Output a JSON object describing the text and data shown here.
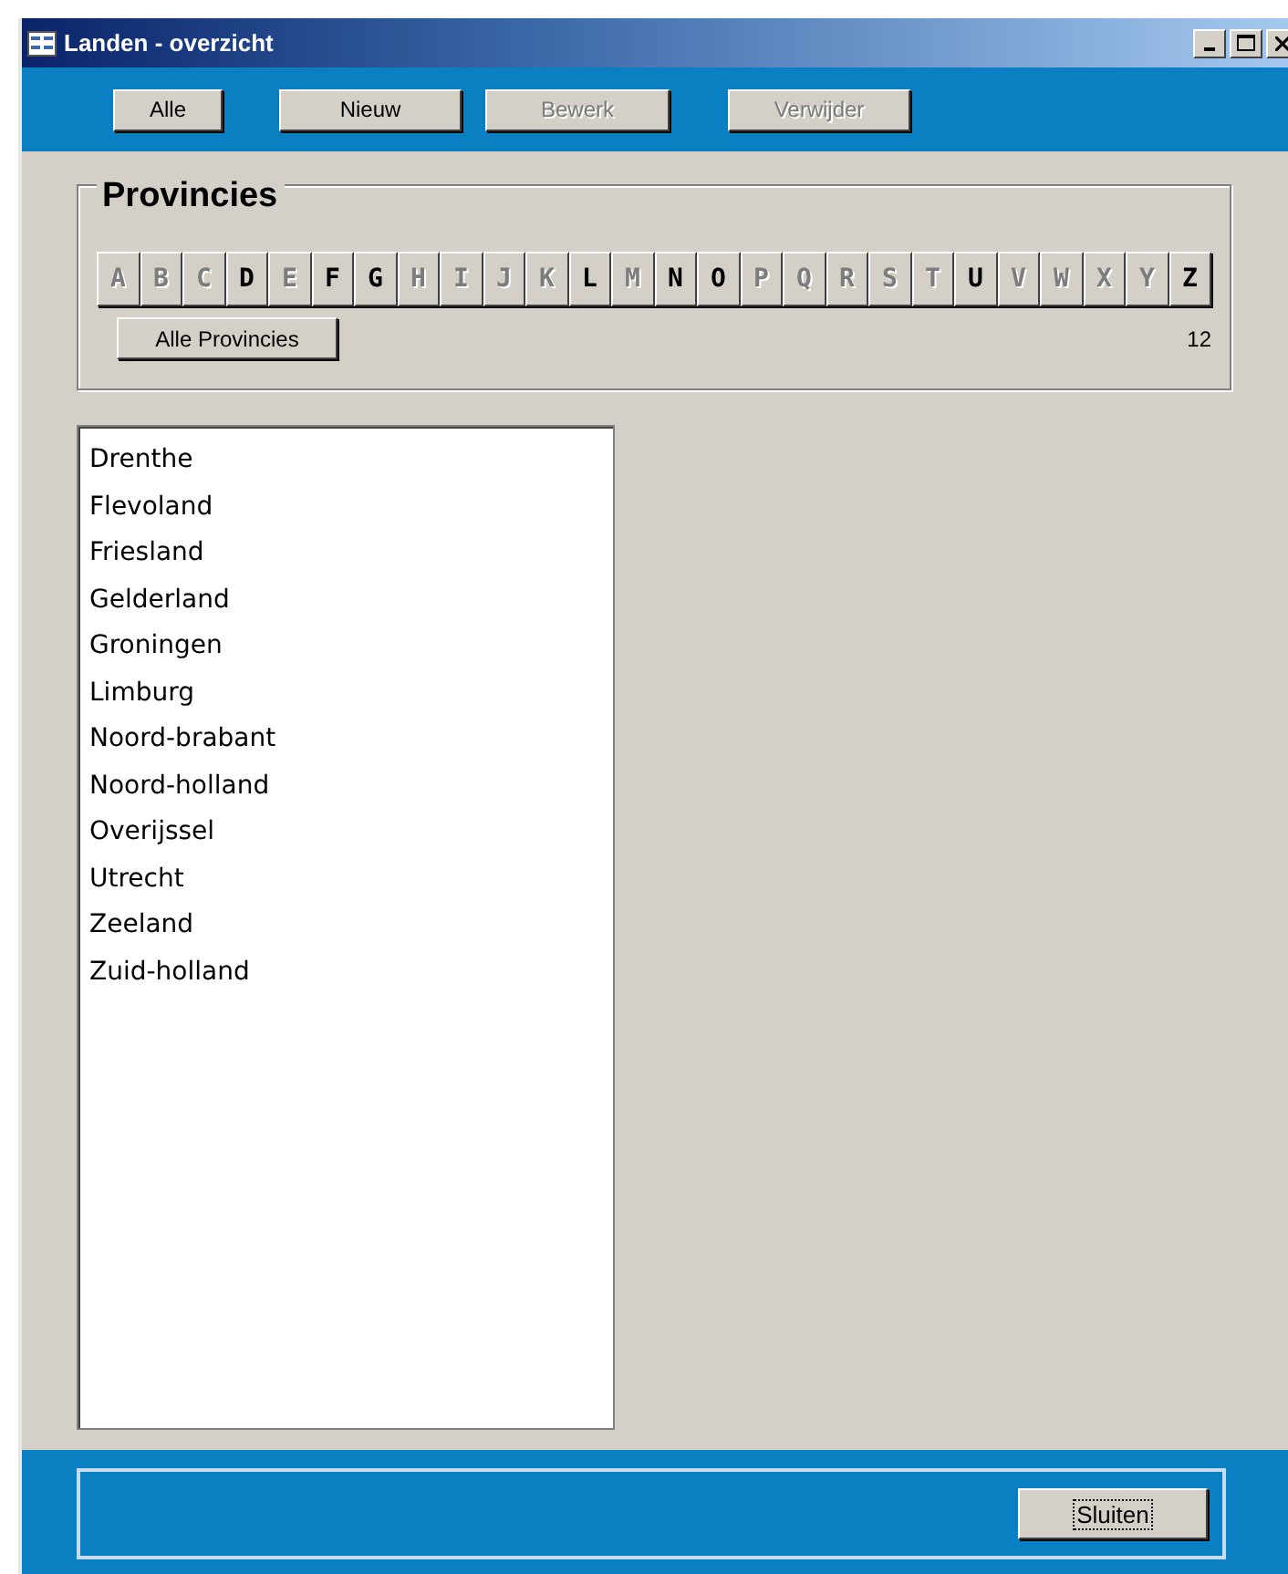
{
  "window": {
    "title": "Landen - overzicht"
  },
  "toolbar": [
    {
      "label": "Alle",
      "disabled": false
    },
    {
      "label": "Nieuw",
      "disabled": false
    },
    {
      "label": "Bewerk",
      "disabled": true
    },
    {
      "label": "Verwijder",
      "disabled": true
    }
  ],
  "group": {
    "title": "Provincies",
    "letters": [
      {
        "label": "A",
        "disabled": true
      },
      {
        "label": "B",
        "disabled": true
      },
      {
        "label": "C",
        "disabled": true
      },
      {
        "label": "D",
        "disabled": false
      },
      {
        "label": "E",
        "disabled": true
      },
      {
        "label": "F",
        "disabled": false
      },
      {
        "label": "G",
        "disabled": false
      },
      {
        "label": "H",
        "disabled": true
      },
      {
        "label": "I",
        "disabled": true
      },
      {
        "label": "J",
        "disabled": true
      },
      {
        "label": "K",
        "disabled": true
      },
      {
        "label": "L",
        "disabled": false
      },
      {
        "label": "M",
        "disabled": true
      },
      {
        "label": "N",
        "disabled": false
      },
      {
        "label": "O",
        "disabled": false
      },
      {
        "label": "P",
        "disabled": true
      },
      {
        "label": "Q",
        "disabled": true
      },
      {
        "label": "R",
        "disabled": true
      },
      {
        "label": "S",
        "disabled": true
      },
      {
        "label": "T",
        "disabled": true
      },
      {
        "label": "U",
        "disabled": false
      },
      {
        "label": "V",
        "disabled": true
      },
      {
        "label": "W",
        "disabled": true
      },
      {
        "label": "X",
        "disabled": true
      },
      {
        "label": "Y",
        "disabled": true
      },
      {
        "label": "Z",
        "disabled": false
      }
    ],
    "all_button": "Alle Provincies",
    "count": "12"
  },
  "list": [
    "Drenthe",
    "Flevoland",
    "Friesland",
    "Gelderland",
    "Groningen",
    "Limburg",
    "Noord-brabant",
    "Noord-holland",
    "Overijssel",
    "Utrecht",
    "Zeeland",
    "Zuid-holland"
  ],
  "footer": {
    "button": {
      "label": "Sluiten",
      "focused": true
    }
  }
}
